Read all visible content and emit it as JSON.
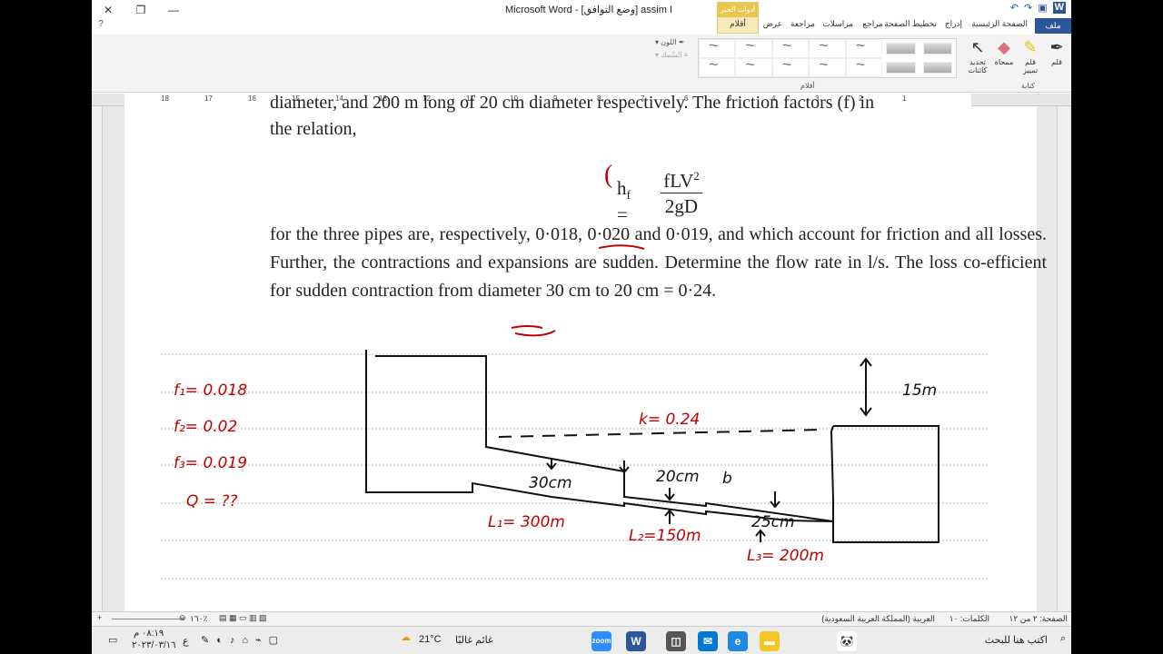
{
  "titlebar": {
    "title": "Microsoft Word - [وضع التوافق] assim I"
  },
  "ribbon": {
    "tabs": [
      "ملف",
      "الصفحة الرئيسية",
      "إدراج",
      "تخطيط الصفحة",
      "مراجع",
      "مراسلات",
      "مراجعة",
      "عرض"
    ],
    "contextual_title": "أدوات الحبر",
    "contextual_tab": "أقلام",
    "write_group": {
      "label": "كتابة",
      "buttons": [
        "قلم",
        "قلم تمييز",
        "ممحاة",
        "تحديد كائنات"
      ]
    },
    "pens_group_label": "أقلام",
    "color_label": "اللون",
    "thickness_label": "السُمك"
  },
  "ruler": {
    "numbers": [
      "18",
      "17",
      "16",
      "15",
      "14",
      "13",
      "12",
      "11",
      "10",
      "9",
      "8",
      "7",
      "6",
      "5",
      "4",
      "3",
      "2",
      "1"
    ]
  },
  "document": {
    "clipped_line": "diameter, and 200 m long of 20 cm diameter respectively. The friction factors (f) in",
    "line1": "the relation,",
    "formula_lhs": "h",
    "formula_sub": "f",
    "formula_num": "fLV",
    "formula_den": "2gD",
    "paragraph": "for the three pipes are, respectively, 0·018, 0·020 and 0·019, and which account for friction and all losses. Further, the contractions and expansions are sudden. Determine the flow rate in l/s. The loss co-efficient for sudden contraction from diameter 30 cm to 20 cm = 0·24."
  },
  "annotations": {
    "f1": "f₁= 0.018",
    "f2": "f₂= 0.02",
    "f3": "f₃= 0.019",
    "q": "Q = ??",
    "k": "k= 0.24",
    "d1": "30cm",
    "d2": "20cm",
    "d3": "25cm",
    "l1": "L₁= 300m",
    "l2": "L₂=150m",
    "l3": "L₃= 200m",
    "head": "15m",
    "b": "b"
  },
  "status": {
    "page": "الصفحة: ٢ من ١٢",
    "words": "الكلمات: ١٠",
    "language": "العربية (المملكة العربية السعودية)",
    "zoom": "١٦٠٪"
  },
  "taskbar": {
    "search": "اكتب هنا للبحث",
    "weather_temp": "21°C",
    "weather_text": "غائم غالبًا",
    "time": "٠٨:١٩ م",
    "date": "٢٠٢٣/٠٣/١٦",
    "lang": "ع"
  },
  "colors": {
    "accent": "#2b579a",
    "ink": "#c00000",
    "contextual": "#e8c64f"
  }
}
